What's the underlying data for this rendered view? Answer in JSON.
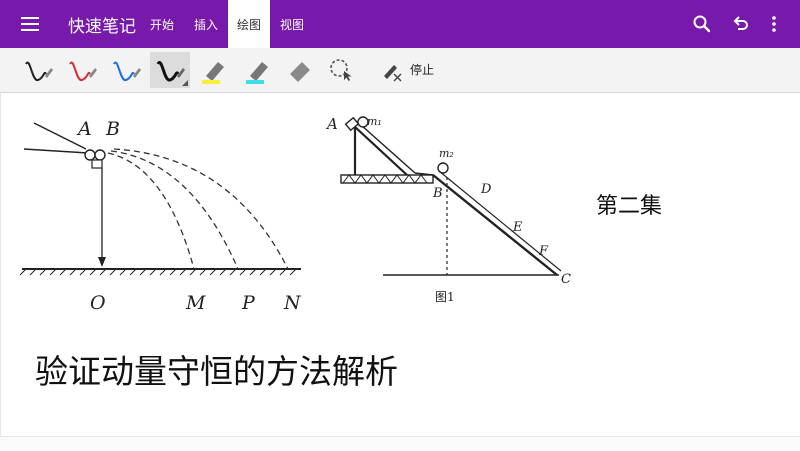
{
  "app": {
    "title": "快速笔记"
  },
  "tabs": [
    {
      "label": "开始",
      "active": false
    },
    {
      "label": "插入",
      "active": false
    },
    {
      "label": "绘图",
      "active": true
    },
    {
      "label": "视图",
      "active": false
    }
  ],
  "toolbar": {
    "stop_label": "停止",
    "pens": [
      {
        "icon": "pen-icon",
        "color": "#222222"
      },
      {
        "icon": "pen-icon",
        "color": "#d32f2f"
      },
      {
        "icon": "pen-icon",
        "color": "#1e6fd9"
      },
      {
        "icon": "pen-icon",
        "color": "#111111",
        "selected": true
      }
    ],
    "highlighters": [
      {
        "icon": "highlighter-icon",
        "color": "#f5f03a"
      },
      {
        "icon": "highlighter-icon",
        "color": "#3ee0e8"
      }
    ]
  },
  "note": {
    "episode_label": "第二集",
    "heading": "验证动量守恒的方法解析",
    "figure1": {
      "labels": [
        "A",
        "B",
        "O",
        "M",
        "P",
        "N"
      ]
    },
    "figure2": {
      "caption": "图1",
      "labels": [
        "A",
        "m₁",
        "m₂",
        "B",
        "D",
        "E",
        "F",
        "C"
      ]
    }
  },
  "colors": {
    "appbar": "#7719aa"
  }
}
